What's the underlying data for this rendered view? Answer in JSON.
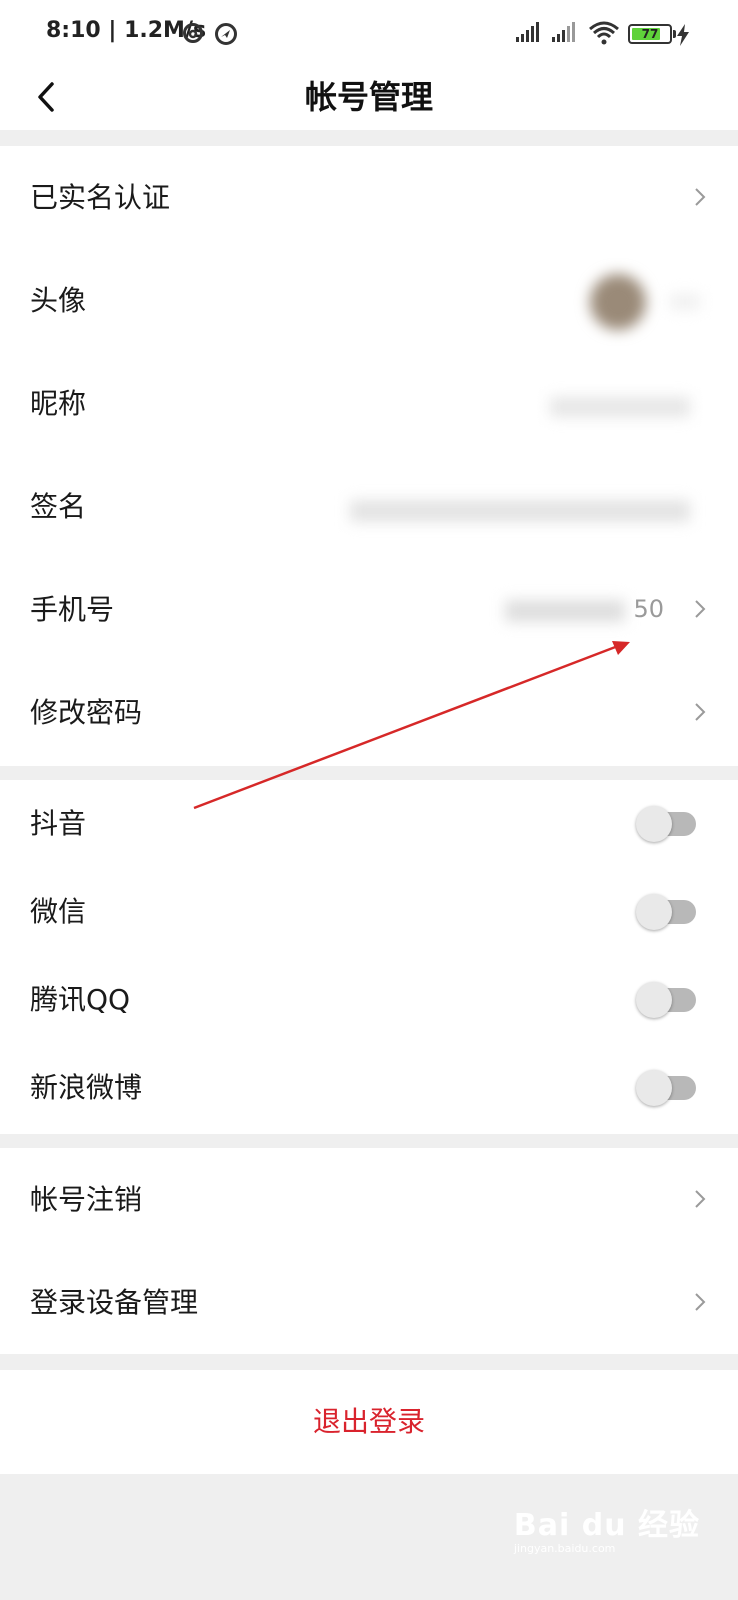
{
  "status_bar": {
    "time": "8:10 | 1.2M/s",
    "battery": "77",
    "battery_level": 0.77,
    "icons": [
      "netease-music-icon",
      "location-icon",
      "signal-icon",
      "signal-icon",
      "wifi-icon",
      "battery-icon",
      "charging-icon"
    ]
  },
  "nav": {
    "title": "帐号管理",
    "back_icon": "back-arrow-icon"
  },
  "section1": {
    "realname": "已实名认证",
    "avatar": "头像",
    "nickname": "昵称",
    "signature": "签名",
    "phone": "手机号",
    "phone_value": "50",
    "password": "修改密码"
  },
  "section2": {
    "items": [
      {
        "label": "抖音",
        "on": false
      },
      {
        "label": "微信",
        "on": false
      },
      {
        "label": "腾讯QQ",
        "on": false
      },
      {
        "label": "新浪微博",
        "on": false
      }
    ]
  },
  "section3": {
    "deactivate": "帐号注销",
    "devices": "登录设备管理"
  },
  "logout": "退出登录",
  "watermark": {
    "brand": "Bai du 经验",
    "url": "jingyan.baidu.com"
  },
  "colors": {
    "accent": "#d9232d",
    "annotation": "#d62828",
    "background": "#efefef"
  }
}
